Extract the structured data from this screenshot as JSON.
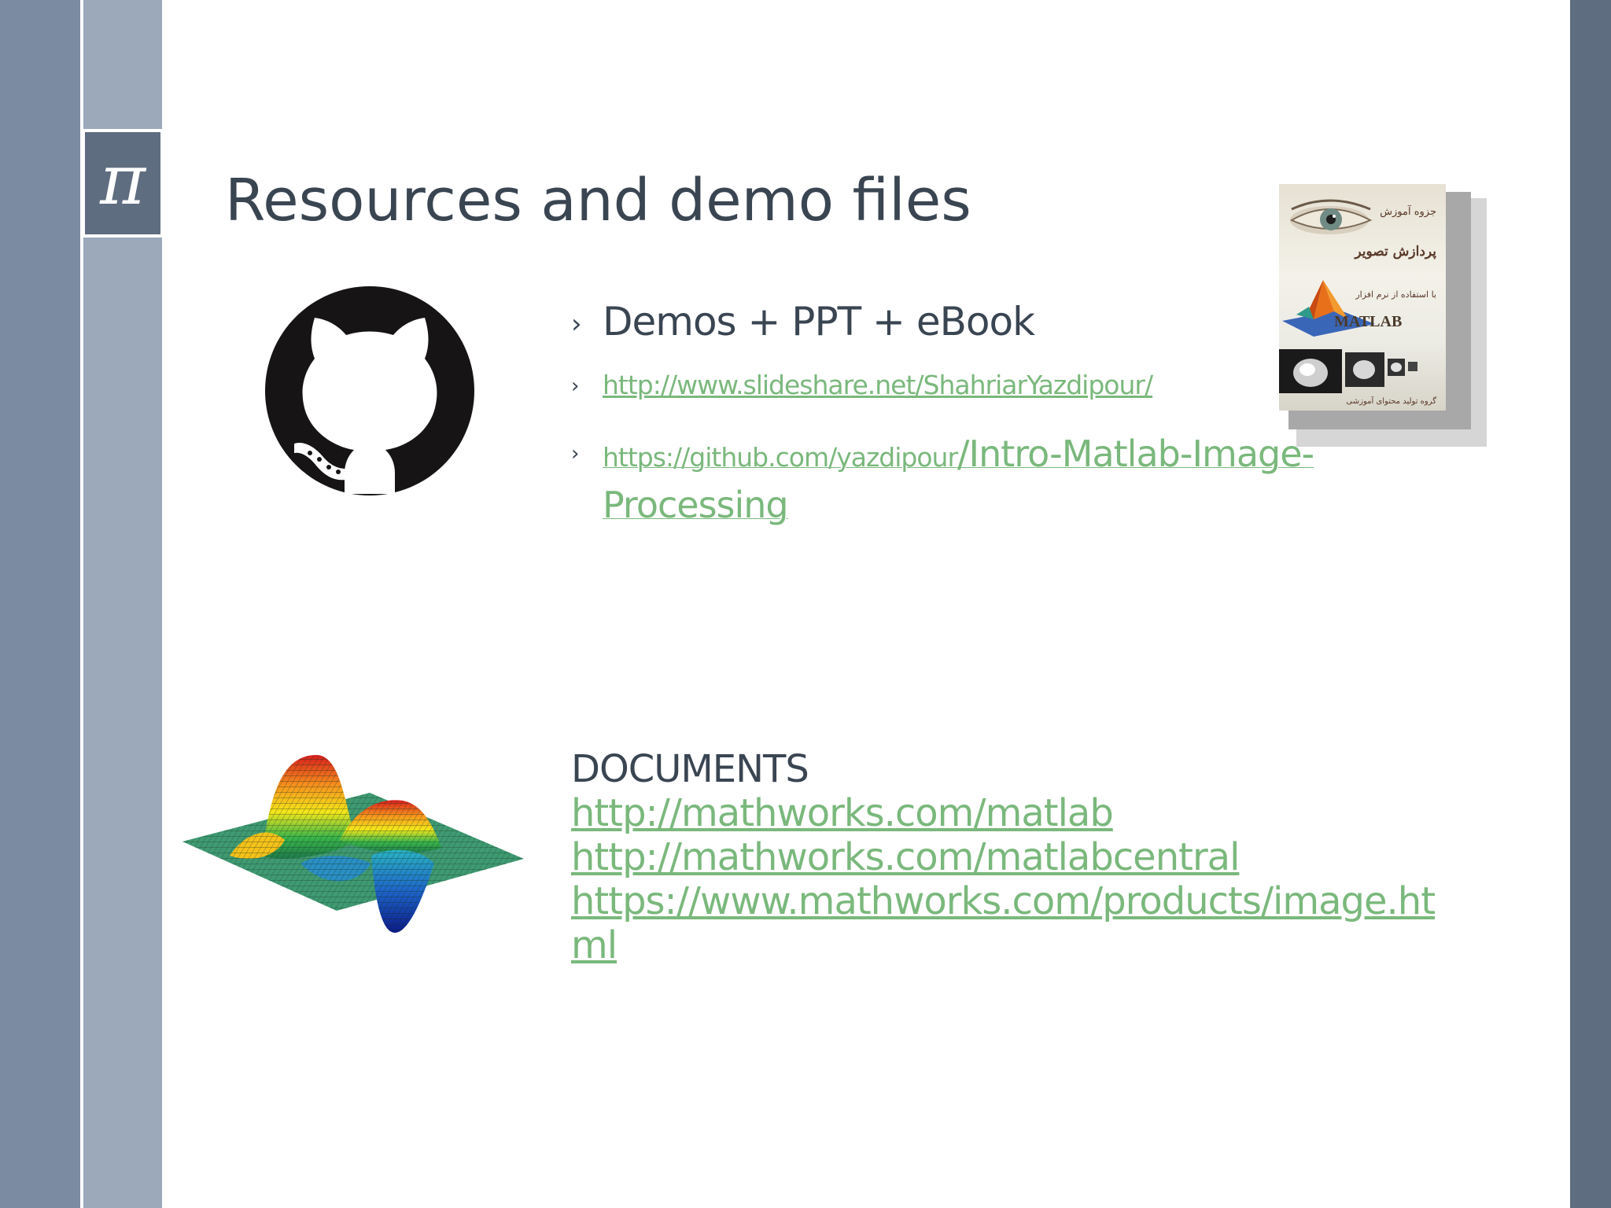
{
  "slide": {
    "title": "Resources and demo files",
    "pi_symbol": "π"
  },
  "bullets": {
    "arrow": "›",
    "heading": "Demos + PPT + eBook",
    "link1": "http://www.slideshare.net/ShahriarYazdipour/",
    "link2_part1": "https://github.com/yazdipour",
    "link2_part2": "/Intro-Matlab-Image-Processing"
  },
  "documents": {
    "heading": "DOCUMENTS",
    "links": [
      "http://mathworks.com/matlab",
      "http://mathworks.com/matlabcentral",
      "https://www.mathworks.com/products/image.html"
    ]
  },
  "book": {
    "persian_line1": "جزوه آموزش",
    "persian_line2": "پردازش تصویر",
    "persian_line3": "با استفاده از نرم افزار",
    "brand": "MATLAB",
    "persian_footer": "گروه تولید محتوای آموزشی"
  },
  "colors": {
    "accent_link": "#7ab87c",
    "text_dark": "#3a4552",
    "band_outer": "#7b8ba1",
    "band_inner": "#9ca9bb",
    "band_right": "#5f6d80"
  },
  "icons": {
    "github": "github-octocat-icon",
    "surface_plot": "matlab-surface-plot-image",
    "book": "matlab-book-cover-image"
  }
}
